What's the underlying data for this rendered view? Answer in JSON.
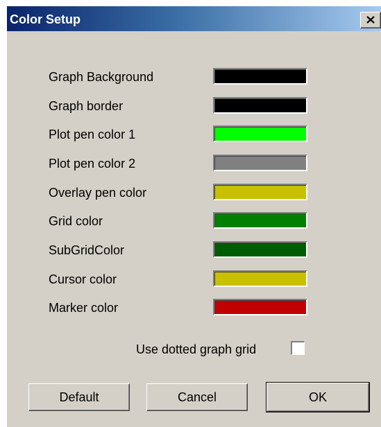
{
  "window": {
    "title": "Color Setup",
    "close_label": "X"
  },
  "colors": [
    {
      "label": "Graph Background",
      "color": "#000000"
    },
    {
      "label": "Graph border",
      "color": "#000000"
    },
    {
      "label": "Plot pen color 1",
      "color": "#00ff00"
    },
    {
      "label": "Plot pen color 2",
      "color": "#808080"
    },
    {
      "label": "Overlay pen color",
      "color": "#c8c000"
    },
    {
      "label": "Grid color",
      "color": "#008000"
    },
    {
      "label": "SubGridColor",
      "color": "#005c00"
    },
    {
      "label": "Cursor color",
      "color": "#c8c000"
    },
    {
      "label": "Marker color",
      "color": "#c00000"
    }
  ],
  "options": {
    "dotted_grid_label": "Use dotted graph grid",
    "dotted_grid_checked": false
  },
  "buttons": {
    "default_label": "Default",
    "cancel_label": "Cancel",
    "ok_label": "OK"
  }
}
